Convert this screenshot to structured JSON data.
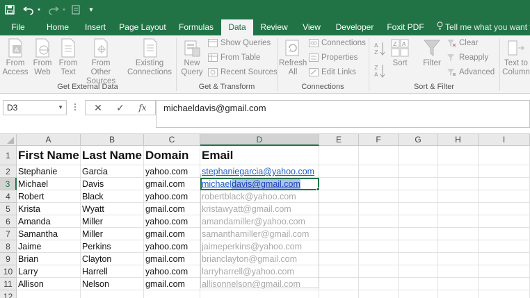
{
  "qat": {
    "save_icon": "save-icon",
    "undo_icon": "undo-icon",
    "redo_icon": "redo-icon",
    "customize_icon": "customize-qat-icon"
  },
  "tabs": [
    {
      "label": "File"
    },
    {
      "label": "Home"
    },
    {
      "label": "Insert"
    },
    {
      "label": "Page Layout"
    },
    {
      "label": "Formulas"
    },
    {
      "label": "Data",
      "active": true
    },
    {
      "label": "Review"
    },
    {
      "label": "View"
    },
    {
      "label": "Developer"
    },
    {
      "label": "Foxit PDF"
    }
  ],
  "tell_me": "Tell me what you want to",
  "ribbon": {
    "get_external": {
      "label": "Get External Data",
      "from_access": "From Access",
      "from_web": "From Web",
      "from_text": "From Text",
      "from_other": "From Other Sources",
      "existing": "Existing Connections"
    },
    "get_transform": {
      "label": "Get & Transform",
      "new_query": "New Query",
      "show_queries": "Show Queries",
      "from_table": "From Table",
      "recent_sources": "Recent Sources"
    },
    "connections": {
      "label": "Connections",
      "refresh_all": "Refresh All",
      "connections": "Connections",
      "properties": "Properties",
      "edit_links": "Edit Links"
    },
    "sort_filter": {
      "label": "Sort & Filter",
      "sort": "Sort",
      "filter": "Filter",
      "clear": "Clear",
      "reapply": "Reapply",
      "advanced": "Advanced"
    },
    "data_tools": {
      "text_to": "Text to",
      "columns": "Column"
    }
  },
  "formula_bar": {
    "name_box": "D3",
    "cancel_symbol": "✕",
    "enter_symbol": "✓",
    "fx_symbol": "fx",
    "value": "michaeldavis@gmail.com"
  },
  "sheet": {
    "columns": [
      "A",
      "B",
      "C",
      "D",
      "E",
      "F",
      "G",
      "H",
      "I"
    ],
    "rows": [
      "1",
      "2",
      "3",
      "4",
      "5",
      "6",
      "7",
      "8",
      "9",
      "10",
      "11",
      "12"
    ],
    "header": [
      "First Name",
      "Last Name",
      "Domain",
      "Email"
    ],
    "data": [
      [
        "Stephanie",
        "Garcia",
        "yahoo.com",
        "stephaniegarcia@yahoo.com"
      ],
      [
        "Michael",
        "Davis",
        "gmail.com",
        "michaeldavis@gmail.com"
      ],
      [
        "Robert",
        "Black",
        "yahoo.com",
        "robertblack@yahoo.com"
      ],
      [
        "Krista",
        "Wyatt",
        "gmail.com",
        "kristawyatt@gmail.com"
      ],
      [
        "Amanda",
        "Miller",
        "yahoo.com",
        "amandamiller@yahoo.com"
      ],
      [
        "Samantha",
        "Miller",
        "gmail.com",
        "samanthamiller@gmail.com"
      ],
      [
        "Jaime",
        "Perkins",
        "yahoo.com",
        "jaimeperkins@yahoo.com"
      ],
      [
        "Brian",
        "Clayton",
        "gmail.com",
        "brianclayton@gmail.com"
      ],
      [
        "Larry",
        "Harrell",
        "yahoo.com",
        "larryharrell@yahoo.com"
      ],
      [
        "Allison",
        "Nelson",
        "gmail.com",
        "allisonnelson@gmail.com"
      ]
    ],
    "active_cell": "D3",
    "d3_typed": "michael",
    "d3_selected": "davis@gmail.com",
    "colors": {
      "accent": "#217346",
      "link": "#1f5fbf",
      "ghost": "#a9a9a9",
      "selection": "#a9c4ea"
    }
  }
}
